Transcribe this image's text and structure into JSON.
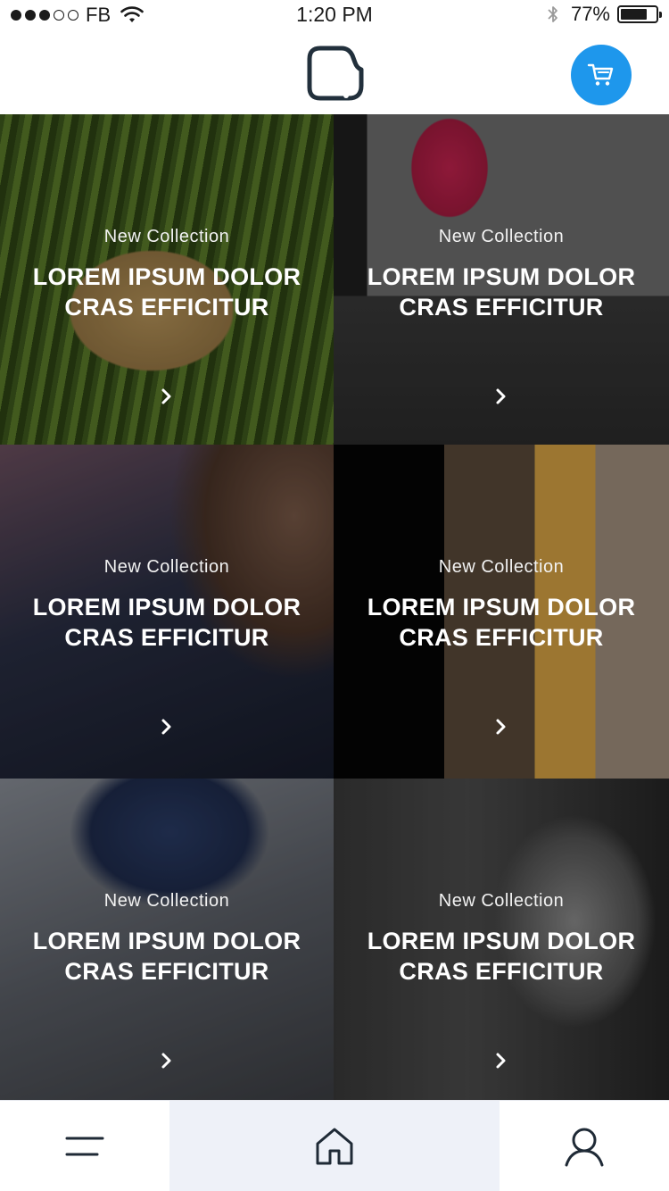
{
  "status_bar": {
    "carrier": "FB",
    "time": "1:20 PM",
    "battery": "77%",
    "battery_level": 0.77,
    "signal_bars_filled": 3,
    "signal_bars_total": 5
  },
  "header": {
    "logo_icon": "rounded-square-logo-icon",
    "cart_icon": "shopping-cart-icon",
    "accent_color": "#1e97ec"
  },
  "collections": [
    {
      "eyebrow": "New Collection",
      "title_line1": "LOREM IPSUM DOLOR",
      "title_line2": "CRAS EFFICITUR",
      "image": "straw hat in grass"
    },
    {
      "eyebrow": "New Collection",
      "title_line1": "LOREM IPSUM DOLOR",
      "title_line2": "CRAS EFFICITUR",
      "image": "red backpack on concrete"
    },
    {
      "eyebrow": "New Collection",
      "title_line1": "LOREM IPSUM DOLOR",
      "title_line2": "CRAS EFFICITUR",
      "image": "man in navy sweater"
    },
    {
      "eyebrow": "New Collection",
      "title_line1": "LOREM IPSUM DOLOR",
      "title_line2": "CRAS EFFICITUR",
      "image": "mustard knit and wooden crate"
    },
    {
      "eyebrow": "New Collection",
      "title_line1": "LOREM IPSUM DOLOR",
      "title_line2": "CRAS EFFICITUR",
      "image": "grey sweater blue collar"
    },
    {
      "eyebrow": "New Collection",
      "title_line1": "LOREM IPSUM DOLOR",
      "title_line2": "CRAS EFFICITUR",
      "image": "woman with sunglasses"
    }
  ],
  "bottom_nav": {
    "items": [
      {
        "icon": "menu-icon"
      },
      {
        "icon": "home-icon",
        "active": true
      },
      {
        "icon": "user-icon"
      }
    ]
  }
}
